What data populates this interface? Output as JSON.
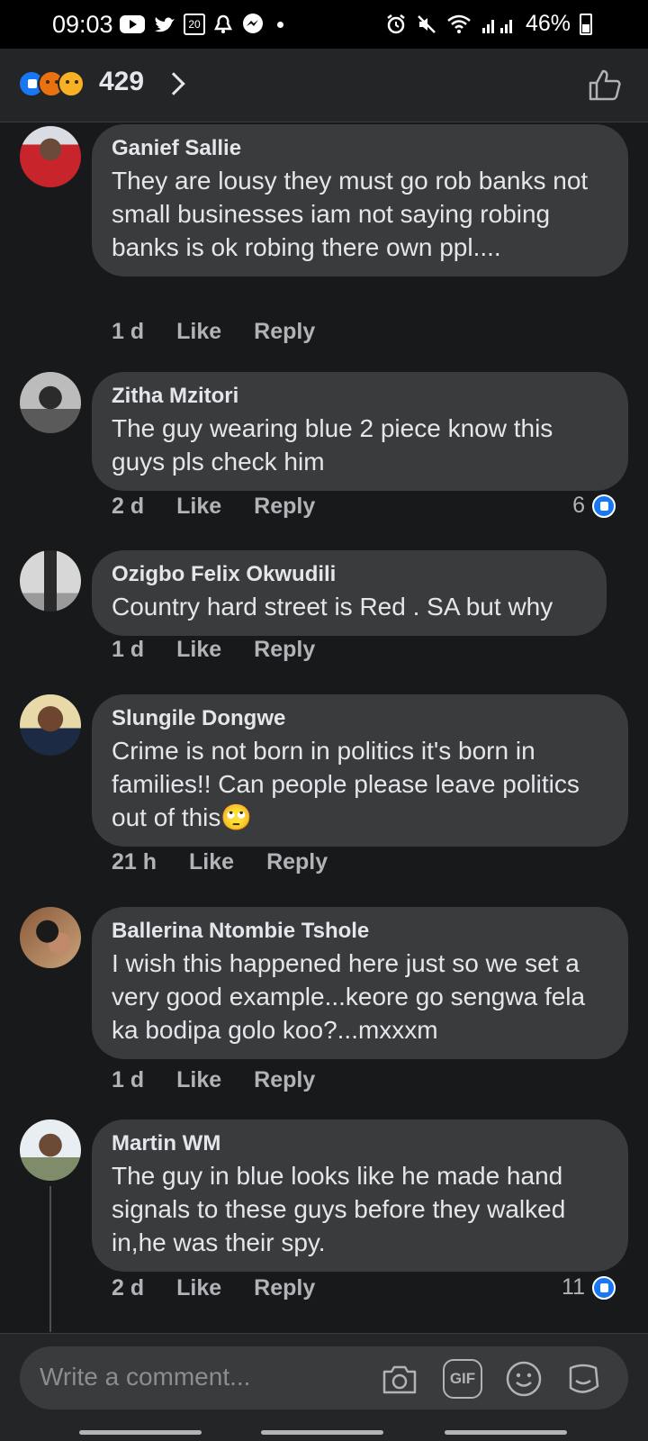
{
  "status_bar": {
    "time": "09:03",
    "battery": "46%",
    "calendar_day": "20"
  },
  "header": {
    "reaction_count": "429",
    "reactions": [
      "like",
      "angry",
      "sad"
    ]
  },
  "comments": [
    {
      "author": "Ganief Sallie",
      "text": "They are lousy  they must go rob banks not small businesses iam not saying robing banks is ok robing there own ppl....",
      "time": "1 d",
      "like_label": "Like",
      "reply_label": "Reply"
    },
    {
      "author": "Zitha Mzitori",
      "text": "The guy wearing blue 2 piece know this guys pls check him",
      "time": "2 d",
      "like_label": "Like",
      "reply_label": "Reply",
      "reaction_count": "6"
    },
    {
      "author": "Ozigbo Felix Okwudili",
      "text": "Country hard street is Red . SA but why",
      "time": "1 d",
      "like_label": "Like",
      "reply_label": "Reply"
    },
    {
      "author": "Slungile Dongwe",
      "text": "Crime is not born in politics it's born in families!! Can people please leave politics out of this🙄",
      "time": "21 h",
      "like_label": "Like",
      "reply_label": "Reply"
    },
    {
      "author": "Ballerina Ntombie Tshole",
      "text": "I wish this happened here just so we set a very good example...keore go sengwa fela ka bodipa golo koo?...mxxxm",
      "time": "1 d",
      "like_label": "Like",
      "reply_label": "Reply"
    },
    {
      "author": "Martin WM",
      "text": "The guy in blue looks like he made hand signals to these guys before they walked in,he was their spy.",
      "time": "2 d",
      "like_label": "Like",
      "reply_label": "Reply",
      "reaction_count": "11"
    }
  ],
  "composer": {
    "placeholder": "Write a comment...",
    "gif_label": "GIF"
  },
  "colors": {
    "background": "#18191a",
    "bubble": "#3a3b3c",
    "accent": "#1877f2",
    "muted_text": "#b0b3b8"
  }
}
